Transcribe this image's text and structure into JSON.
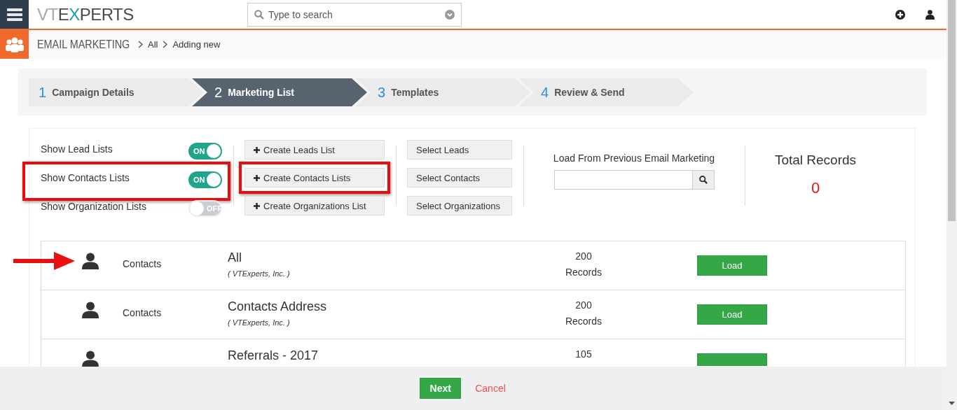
{
  "topbar": {
    "logo": [
      {
        "text": "VT",
        "color": "#a7a9ac"
      },
      {
        "text": "E",
        "color": "#4a4a4a"
      },
      {
        "text": "X",
        "color": "#1b9bb5"
      },
      {
        "text": "PERTS",
        "color": "#4a4a4a"
      }
    ],
    "search": {
      "placeholder": "Type to search"
    }
  },
  "breadcrumb": {
    "module": "EMAIL MARKETING",
    "items": [
      "All",
      "Adding new"
    ]
  },
  "steps": [
    {
      "number": "1",
      "label": "Campaign Details",
      "selected": false
    },
    {
      "number": "2",
      "label": "Marketing List",
      "selected": true
    },
    {
      "number": "3",
      "label": "Templates",
      "selected": false
    },
    {
      "number": "4",
      "label": "Review & Send",
      "selected": false
    }
  ],
  "toggles": [
    {
      "label": "Show Lead Lists",
      "on": true,
      "state_label": "ON",
      "highlighted": false
    },
    {
      "label": "Show Contacts Lists",
      "on": true,
      "state_label": "ON",
      "highlighted": true
    },
    {
      "label": "Show Organization Lists",
      "on": false,
      "state_label": "OFF",
      "highlighted": false
    }
  ],
  "create_buttons": [
    {
      "label": "Create Leads List",
      "highlighted": false
    },
    {
      "label": "Create Contacts Lists",
      "highlighted": true
    },
    {
      "label": "Create Organizations List",
      "highlighted": false
    }
  ],
  "select_buttons": [
    "Select Leads",
    "Select Contacts",
    "Select Organizations"
  ],
  "load_previous": {
    "label": "Load From Previous Email Marketing"
  },
  "total": {
    "label": "Total Records",
    "value": "0"
  },
  "lists": [
    {
      "module": "Contacts",
      "name": "All",
      "owner": "( VTExperts, Inc. )",
      "count": "200",
      "unit": "Records",
      "action": "Load",
      "pointed": true
    },
    {
      "module": "Contacts",
      "name": "Contacts Address",
      "owner": "( VTExperts, Inc. )",
      "count": "200",
      "unit": "Records",
      "action": "Load",
      "pointed": false
    },
    {
      "name": "Referrals - 2017",
      "count": "105",
      "pointed": false
    }
  ],
  "footer": {
    "next": "Next",
    "cancel": "Cancel"
  }
}
